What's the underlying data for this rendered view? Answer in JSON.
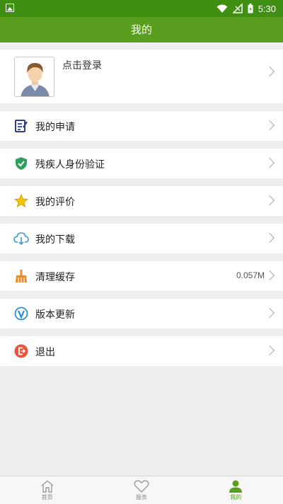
{
  "status_bar": {
    "time": "5:30"
  },
  "header": {
    "title": "我的"
  },
  "profile": {
    "login_text": "点击登录"
  },
  "menu": [
    {
      "label": "我的申请",
      "icon": "application-icon",
      "color": "#2b3f8c"
    },
    {
      "label": "残疾人身份验证",
      "icon": "shield-check-icon",
      "color": "#2fa05c"
    },
    {
      "label": "我的评价",
      "icon": "star-icon",
      "color": "#f4c400"
    },
    {
      "label": "我的下载",
      "icon": "cloud-download-icon",
      "color": "#3d9ad6"
    },
    {
      "label": "清理缓存",
      "icon": "broom-icon",
      "color": "#f08a24",
      "value": "0.057M"
    },
    {
      "label": "版本更新",
      "icon": "version-update-icon",
      "color": "#2d8fd5"
    },
    {
      "label": "退出",
      "icon": "logout-icon",
      "color": "#e8553f"
    }
  ],
  "tabs": [
    {
      "label": "首页",
      "icon": "home-icon",
      "active": false
    },
    {
      "label": "服务",
      "icon": "heart-icon",
      "active": false
    },
    {
      "label": "我的",
      "icon": "person-icon",
      "active": true
    }
  ],
  "colors": {
    "status_bar": "#3f8f12",
    "header": "#5a9e1f",
    "accent": "#5a9e1f"
  }
}
